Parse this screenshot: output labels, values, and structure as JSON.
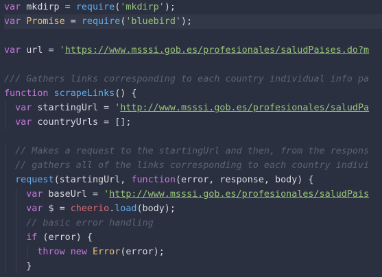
{
  "lines": [
    {
      "tokens": [
        {
          "t": "var",
          "c": "kw"
        },
        {
          "t": " mkdirp = ",
          "c": "var"
        },
        {
          "t": "require",
          "c": "fn"
        },
        {
          "t": "(",
          "c": "punc"
        },
        {
          "t": "'mkdirp'",
          "c": "str"
        },
        {
          "t": ");",
          "c": "punc"
        }
      ]
    },
    {
      "active": true,
      "tokens": [
        {
          "t": "var",
          "c": "kw"
        },
        {
          "t": " ",
          "c": "var"
        },
        {
          "t": "Promise",
          "c": "cls"
        },
        {
          "t": " = ",
          "c": "var"
        },
        {
          "t": "require",
          "c": "fn"
        },
        {
          "t": "(",
          "c": "punc"
        },
        {
          "t": "'bluebird'",
          "c": "str"
        },
        {
          "t": ");",
          "c": "punc"
        }
      ]
    },
    {
      "tokens": []
    },
    {
      "tokens": [
        {
          "t": "var",
          "c": "kw"
        },
        {
          "t": " url = ",
          "c": "var"
        },
        {
          "t": "'",
          "c": "str"
        },
        {
          "t": "https://www.msssi.gob.es/profesionales/saludPaises.do?m",
          "c": "url"
        }
      ]
    },
    {
      "tokens": []
    },
    {
      "tokens": [
        {
          "t": "/// Gathers links corresponding to each country individual info pa",
          "c": "cmt"
        }
      ]
    },
    {
      "tokens": [
        {
          "t": "function",
          "c": "kw"
        },
        {
          "t": " ",
          "c": "var"
        },
        {
          "t": "scrapeLinks",
          "c": "fn"
        },
        {
          "t": "() {",
          "c": "punc"
        }
      ]
    },
    {
      "indent": 1,
      "tokens": [
        {
          "t": "var",
          "c": "kw"
        },
        {
          "t": " startingUrl = ",
          "c": "var"
        },
        {
          "t": "'",
          "c": "str"
        },
        {
          "t": "http://www.msssi.gob.es/profesionales/saludPa",
          "c": "url"
        }
      ]
    },
    {
      "indent": 1,
      "tokens": [
        {
          "t": "var",
          "c": "kw"
        },
        {
          "t": " countryUrls = [];",
          "c": "var"
        }
      ]
    },
    {
      "tokens": []
    },
    {
      "indent": 1,
      "tokens": [
        {
          "t": "// Makes a request to the startingUrl and then, from the respons",
          "c": "cmt"
        }
      ]
    },
    {
      "indent": 1,
      "tokens": [
        {
          "t": "// gathers all of the links corresponding to each country indivi",
          "c": "cmt"
        }
      ]
    },
    {
      "indent": 1,
      "tokens": [
        {
          "t": "request",
          "c": "fn"
        },
        {
          "t": "(startingUrl, ",
          "c": "var"
        },
        {
          "t": "function",
          "c": "kw"
        },
        {
          "t": "(error, response, body) {",
          "c": "var"
        }
      ]
    },
    {
      "indent": 2,
      "tokens": [
        {
          "t": "var",
          "c": "kw"
        },
        {
          "t": " baseUrl = ",
          "c": "var"
        },
        {
          "t": "'",
          "c": "str"
        },
        {
          "t": "http://www.msssi.gob.es/profesionales/saludPais",
          "c": "url"
        }
      ]
    },
    {
      "indent": 2,
      "tokens": [
        {
          "t": "var",
          "c": "kw"
        },
        {
          "t": " $ = ",
          "c": "var"
        },
        {
          "t": "cheerio",
          "c": "red"
        },
        {
          "t": ".",
          "c": "punc"
        },
        {
          "t": "load",
          "c": "fn"
        },
        {
          "t": "(body);",
          "c": "var"
        }
      ]
    },
    {
      "indent": 2,
      "tokens": [
        {
          "t": "// basic error handling",
          "c": "cmt"
        }
      ]
    },
    {
      "indent": 2,
      "tokens": [
        {
          "t": "if",
          "c": "kw"
        },
        {
          "t": " (error) {",
          "c": "var"
        }
      ]
    },
    {
      "indent": 3,
      "tokens": [
        {
          "t": "throw",
          "c": "kw"
        },
        {
          "t": " ",
          "c": "var"
        },
        {
          "t": "new",
          "c": "kw"
        },
        {
          "t": " ",
          "c": "var"
        },
        {
          "t": "Error",
          "c": "cls"
        },
        {
          "t": "(error);",
          "c": "var"
        }
      ]
    },
    {
      "indent": 2,
      "tokens": [
        {
          "t": "}",
          "c": "punc"
        }
      ]
    }
  ]
}
